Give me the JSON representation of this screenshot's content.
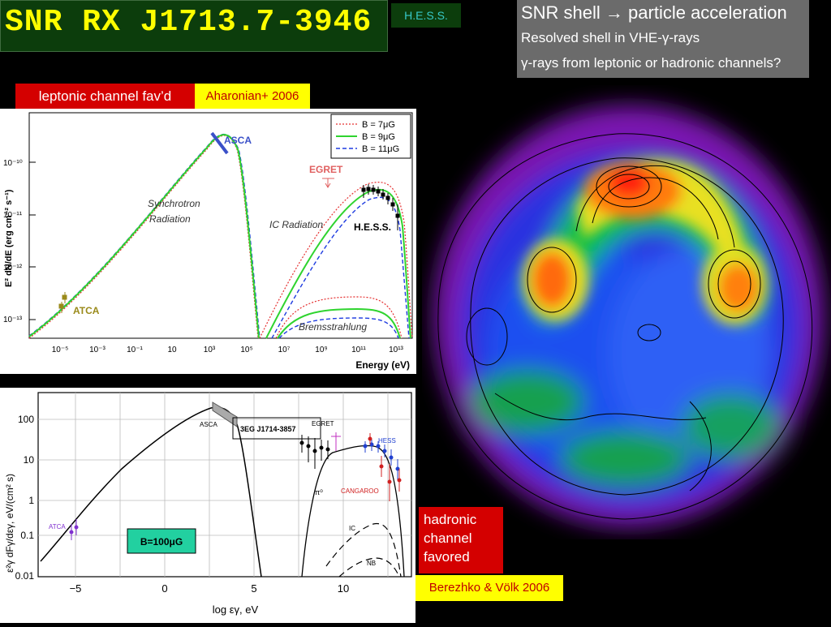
{
  "header": {
    "title": "SNR RX J1713.7-3946",
    "hess_tag": "H.E.S.S."
  },
  "info": {
    "line1": "SNR shell → particle acceleration",
    "line2": "Resolved shell in VHE-γ-rays",
    "line3": "γ-rays from leptonic or hadronic channels?"
  },
  "tags": {
    "leptonic": "leptonic channel fav’d",
    "aharonian": "Aharonian+ 2006",
    "hadronic_lines": [
      "hadronic",
      "channel",
      "favored"
    ],
    "berezhko": "Berezhko & Völk 2006"
  },
  "colors": {
    "title_bg": "#0c3d0c",
    "title_fg": "#ffff00",
    "red_tag": "#d40000",
    "yellow_tag": "#ffff00",
    "info_bg": "#6b6b6b"
  },
  "chart_data": [
    {
      "type": "line",
      "x_scale": "log",
      "y_scale": "log",
      "xlabel": "Energy (eV)",
      "ylabel": "E² dN/dE (erg cm⁻² s⁻¹)",
      "xlim": [
        3e-06,
        100000000000000.0
      ],
      "ylim": [
        6e-14,
        8e-10
      ],
      "x_ticks": [
        "10⁻⁵",
        "10⁻³",
        "10⁻¹",
        "10",
        "10³",
        "10⁵",
        "10⁷",
        "10⁹",
        "10¹¹",
        "10¹³"
      ],
      "y_ticks": [
        "10⁻¹⁰",
        "10⁻¹¹",
        "10⁻¹²",
        "10⁻¹³"
      ],
      "legend": [
        "B = 7μG",
        "B = 9μG",
        "B = 11μG"
      ],
      "legend_position": "top-right",
      "annotations": [
        "ASCA",
        "EGRET",
        "Synchrotron",
        "Radiation",
        "IC Radiation",
        "H.E.S.S.",
        "ATCA",
        "Bremsstrahlung"
      ],
      "series": [
        {
          "name": "B = 9μG",
          "color": "#22cc22",
          "x": [
            1e-05,
            0.001,
            0.1,
            10,
            1000,
            100000,
            1000000
          ],
          "y": [
            7e-14,
            5e-13,
            3.5e-12,
            2.5e-11,
            3e-10,
            2e-12,
            5e-14
          ]
        },
        {
          "name": "B = 9μG (IC)",
          "color": "#22cc22",
          "x": [
            10000000.0,
            1000000000.0,
            100000000000.0,
            1000000000000.0,
            10000000000000.0,
            30000000000000.0
          ],
          "y": [
            4e-14,
            9e-13,
            1e-11,
            2.2e-11,
            2e-11,
            3e-13
          ]
        }
      ]
    },
    {
      "type": "line",
      "xlabel": "log εγ, eV",
      "ylabel": "ε²γ dFγ/dεγ, eV/(cm² s)",
      "xlim": [
        -7,
        14
      ],
      "ylim": [
        0.01,
        200
      ],
      "x_ticks": [
        "−5",
        "0",
        "5",
        "10"
      ],
      "y_ticks": [
        "100",
        "10",
        "1",
        "0.1",
        "0.01"
      ],
      "annotations": [
        "ASCA",
        "3EG J1714-3857",
        "EGRET",
        "HESS",
        "CANGAROO",
        "π⁰",
        "IC",
        "NB",
        "ATCA"
      ],
      "box_label": "B=100μG",
      "series": [
        {
          "name": "total",
          "color": "#000000",
          "x": [
            -7,
            -5,
            0,
            2.7,
            5,
            7.5,
            10,
            12,
            13.5
          ],
          "y": [
            0.02,
            0.15,
            15,
            150,
            2,
            0.02,
            15,
            20,
            0.5
          ]
        }
      ]
    }
  ]
}
